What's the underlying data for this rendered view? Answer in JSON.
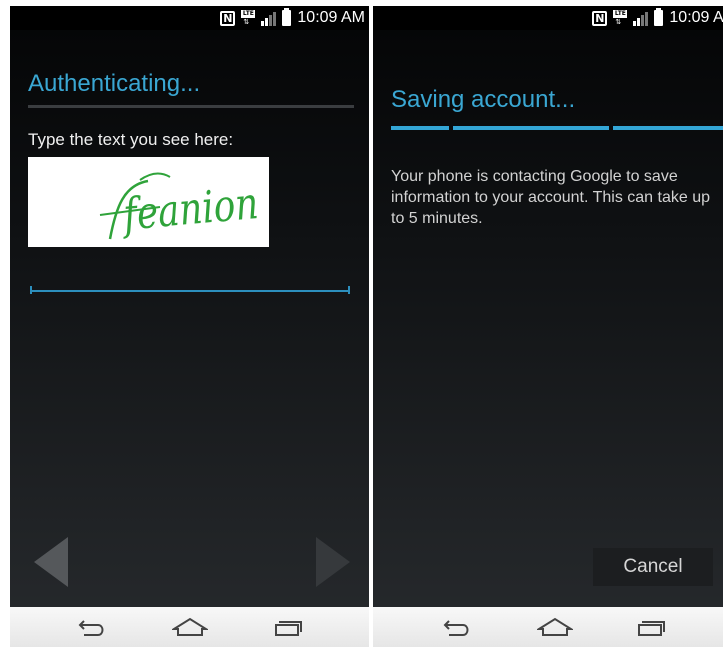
{
  "status_bar": {
    "time": "10:09 AM",
    "nfc_letter": "N",
    "lte_label": "LTE"
  },
  "auth_screen": {
    "title": "Authenticating...",
    "captcha_prompt": "Type the text you see here:",
    "captcha_text": "feanion",
    "captcha_input_value": ""
  },
  "saving_screen": {
    "title": "Saving account...",
    "message": "Your phone is contacting Google to save information to your account. This can take up to 5 minutes.",
    "cancel_label": "Cancel"
  },
  "colors": {
    "accent": "#3aa7d3",
    "captcha_ink": "#2fa33a",
    "background": "#0f1113",
    "nav_bar": "#f0f0f0"
  },
  "icons": {
    "back": "back-icon",
    "home": "home-icon",
    "recents": "recents-icon",
    "prev": "arrow-left-icon",
    "next": "arrow-right-icon"
  }
}
